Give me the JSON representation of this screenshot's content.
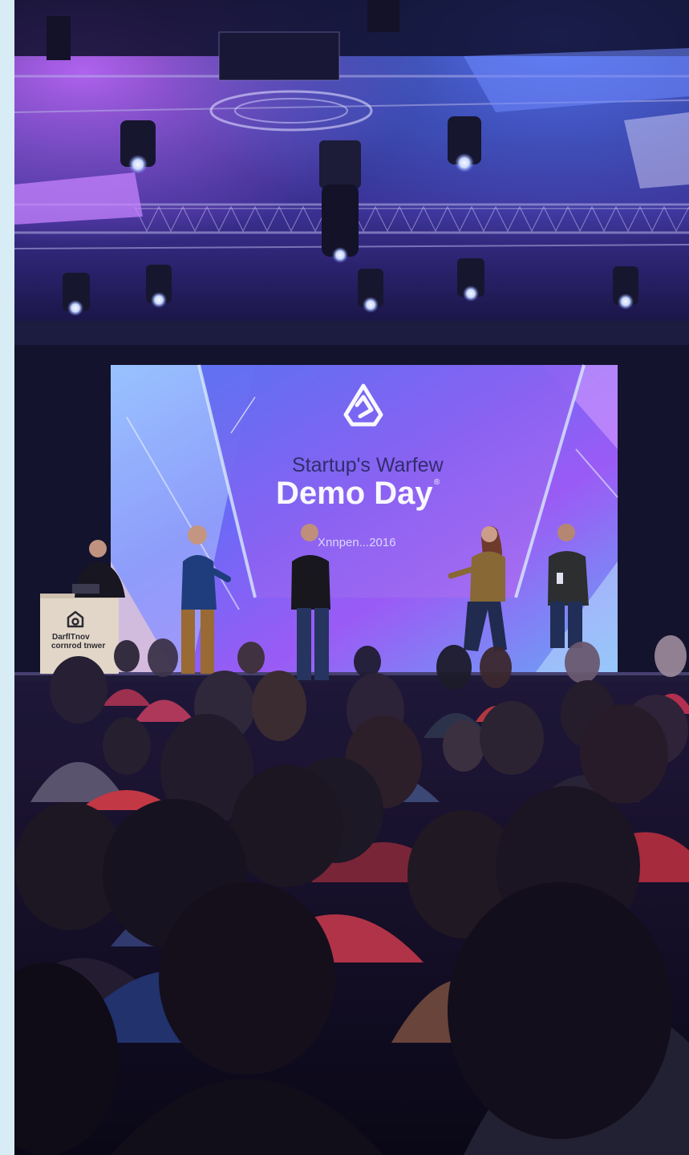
{
  "screen": {
    "title_line1": "Startup's Warfew",
    "title_line2": "Demo Day",
    "registered_mark": "®",
    "subtitle": "Xnnpen...2016"
  },
  "podium": {
    "line1": "DarflTnov",
    "line2": "cornrod tnwer"
  },
  "colors": {
    "page_margin": "#d7ecf4",
    "venue_dark": "#0b0a1e",
    "stage_light_blue": "#3b5cff",
    "stage_light_purple": "#a04cff",
    "screen_purple": "#8b5cf6",
    "screen_blue": "#4f7fff"
  },
  "icons": {
    "screen_logo": "rounded-triangle-loop-logo",
    "podium_logo": "house-loop-logo"
  }
}
